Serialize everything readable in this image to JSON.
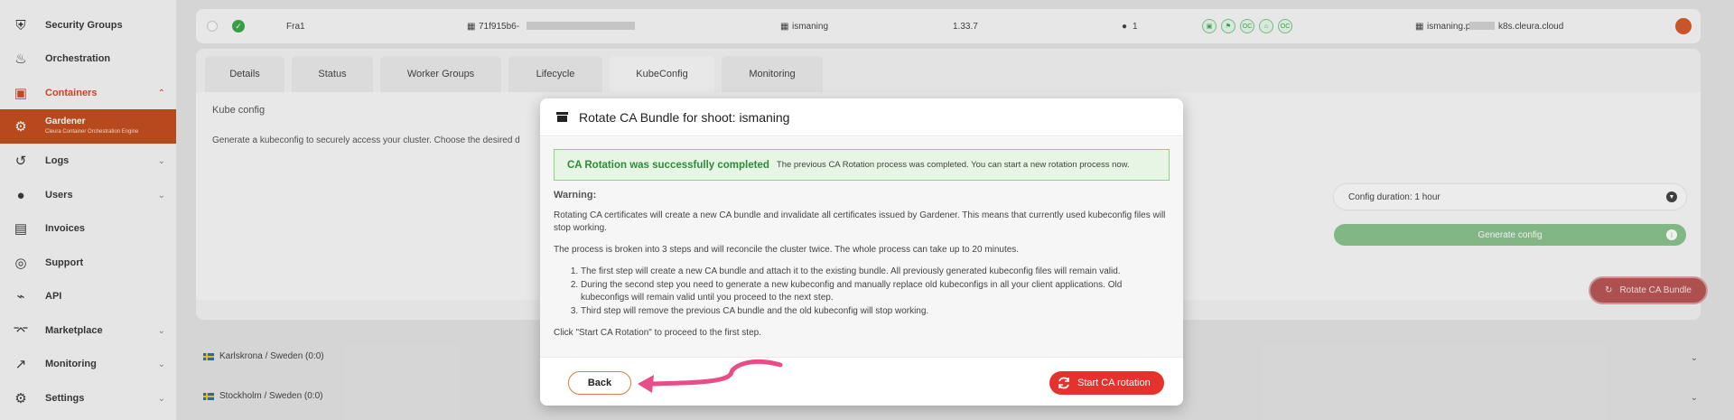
{
  "sidebar": {
    "items": [
      {
        "label": "Security Groups",
        "icon": "shield-icon"
      },
      {
        "label": "Orchestration",
        "icon": "flame-icon"
      },
      {
        "label": "Containers",
        "icon": "box-icon",
        "expanded": true
      },
      {
        "label": "Gardener",
        "sub": "Cleura Container Orchestration Engine",
        "icon": "gear-icon",
        "active": true
      },
      {
        "label": "Logs",
        "icon": "history-icon"
      },
      {
        "label": "Users",
        "icon": "user-icon"
      },
      {
        "label": "Invoices",
        "icon": "invoice-icon"
      },
      {
        "label": "Support",
        "icon": "support-icon"
      },
      {
        "label": "API",
        "icon": "plug-icon"
      },
      {
        "label": "Marketplace",
        "icon": "cart-icon"
      },
      {
        "label": "Monitoring",
        "icon": "chart-icon"
      },
      {
        "label": "Settings",
        "icon": "settings-icon"
      }
    ]
  },
  "shoot": {
    "name": "Fra1",
    "id": "71f915b6-",
    "cluster": "ismaning",
    "version": "1.33.7",
    "count": "1",
    "endpoint_prefix": "ismaning.p",
    "endpoint_suffix": "k8s.cleura.cloud"
  },
  "tabs": [
    "Details",
    "Status",
    "Worker Groups",
    "Lifecycle",
    "KubeConfig",
    "Monitoring"
  ],
  "kubeconfig": {
    "title": "Kube config",
    "description": "Generate a kubeconfig to securely access your cluster. Choose the desired d",
    "duration": "Config duration: 1 hour",
    "generate_label": "Generate config",
    "rotate_label": "Rotate CA Bundle"
  },
  "regions": [
    "Karlskrona / Sweden (0:0)",
    "Stockholm / Sweden (0:0)"
  ],
  "modal": {
    "title": "Rotate CA Bundle for shoot: ismaning",
    "success_strong": "CA Rotation was successfully completed",
    "success_small": "The previous CA Rotation process was completed. You can start a new rotation process now.",
    "warning_title": "Warning:",
    "para1": "Rotating CA certificates will create a new CA bundle and invalidate all certificates issued by Gardener. This means that currently used kubeconfig files will stop working.",
    "para2": "The process is broken into 3 steps and will reconcile the cluster twice. The whole process can take up to 20 minutes.",
    "steps": [
      "The first step will create a new CA bundle and attach it to the existing bundle. All previously generated kubeconfig files will remain valid.",
      "During the second step you need to generate a new kubeconfig and manually replace old kubeconfigs in all your client applications. Old kubeconfigs will remain valid until you proceed to the next step.",
      "Third step will remove the previous CA bundle and the old kubeconfig will stop working."
    ],
    "para3": "Click \"Start CA Rotation\" to proceed to the first step.",
    "back_label": "Back",
    "start_label": "Start CA rotation"
  },
  "colors": {
    "accent": "#c24f1f",
    "danger": "#e6322d",
    "success": "#2e8b3a",
    "annotation": "#e84d8a"
  }
}
